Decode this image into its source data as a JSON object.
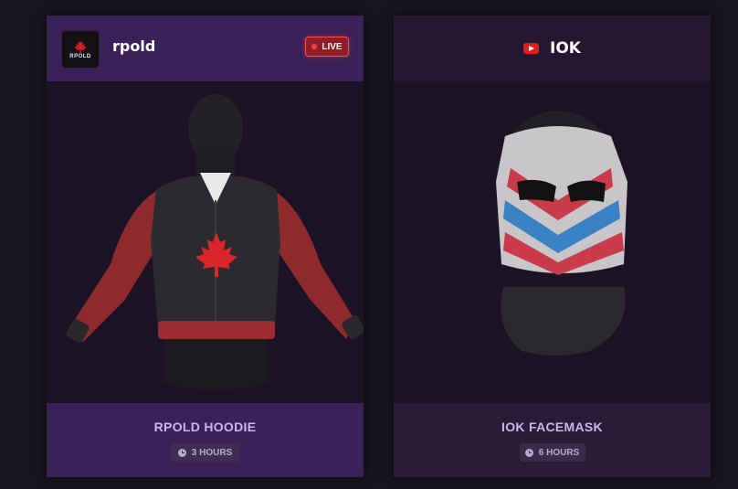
{
  "cards": [
    {
      "streamer": "rpold",
      "avatar_text": "RPOLD",
      "live_label": "LIVE",
      "item_name": "RPOLD HOODIE",
      "time_left": "3 HOURS"
    },
    {
      "channel": "IOK",
      "channel_icon": "youtube-icon",
      "item_name": "IOK FACEMASK",
      "time_left": "6 HOURS"
    }
  ],
  "colors": {
    "background": "#17131f",
    "header_purple": "#3a2258",
    "live_red": "#ff3b3b",
    "title_lavender": "#c8b6ec"
  }
}
